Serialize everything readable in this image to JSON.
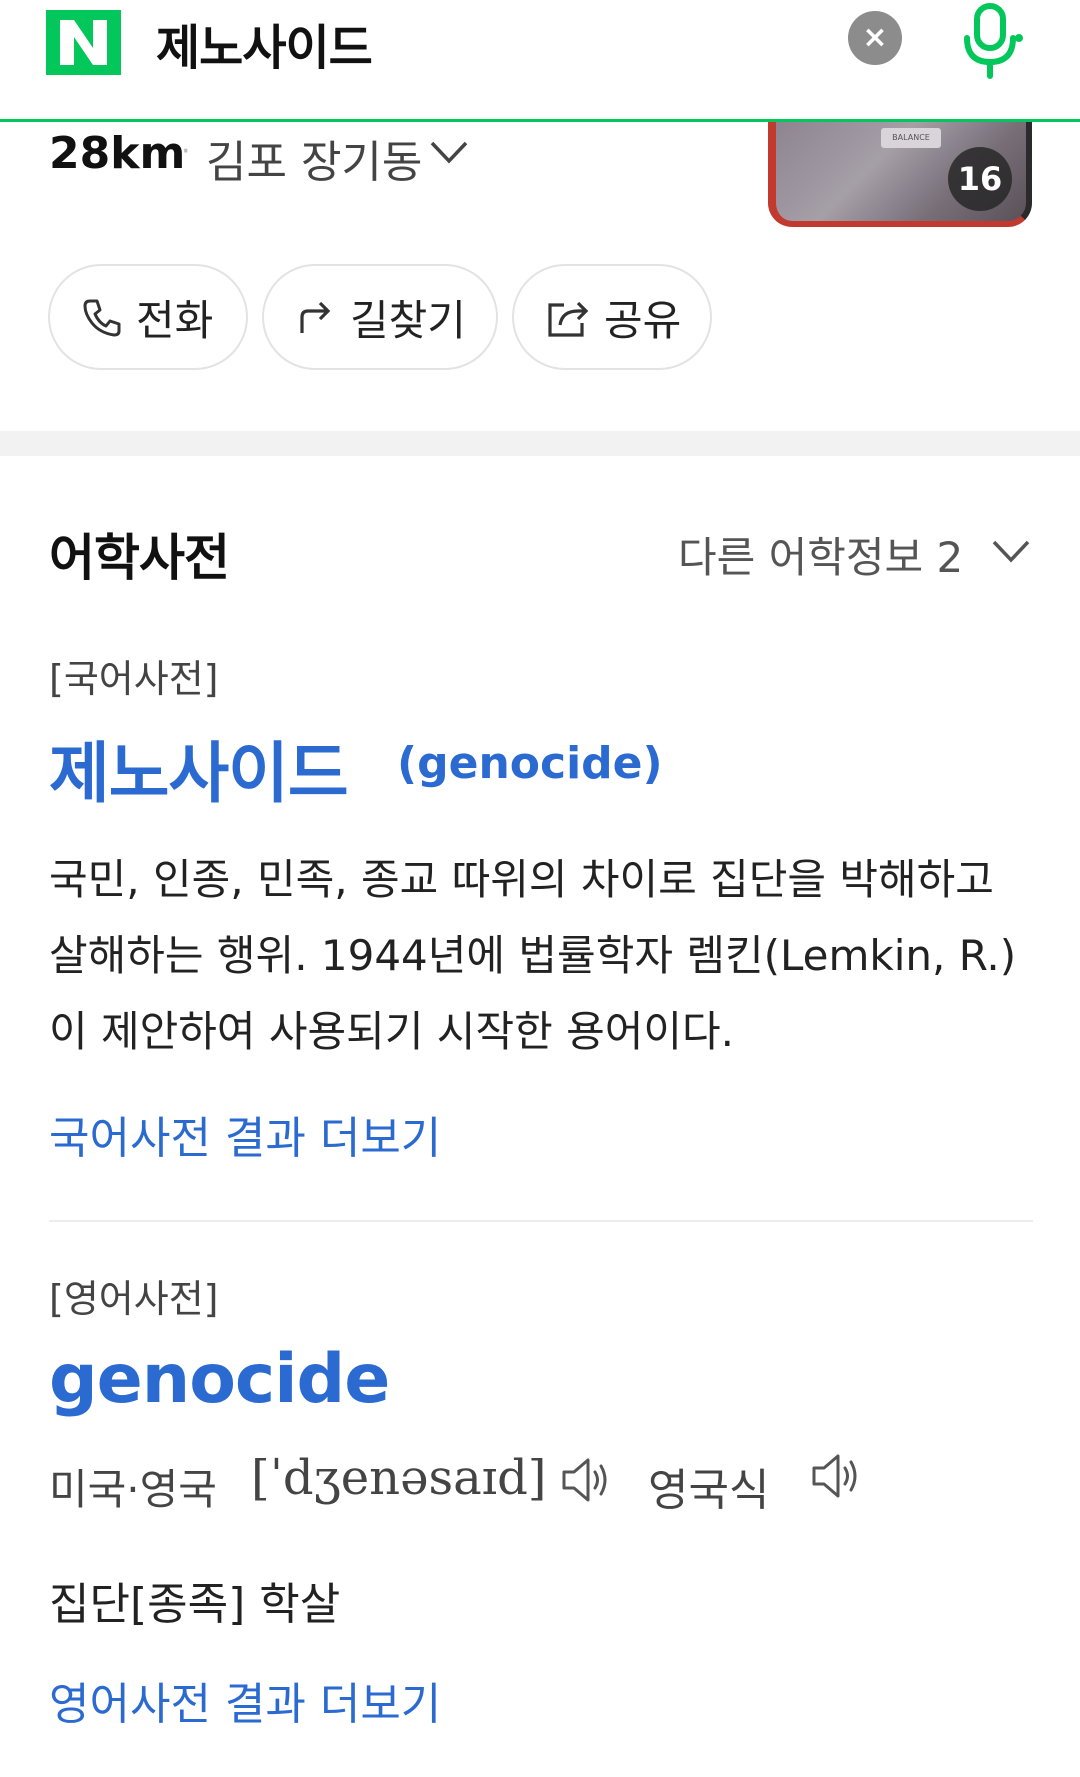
{
  "header": {
    "query": "제노사이드",
    "clear_icon": "×",
    "brand_color": "#03c75a"
  },
  "place": {
    "distance": "28km",
    "dot": "·",
    "address": "김포 장기동",
    "photo_count": "16",
    "photo_tag": "BALANCE",
    "actions": {
      "call": "전화",
      "route": "길찾기",
      "share": "공유"
    }
  },
  "dictionary": {
    "section_title": "어학사전",
    "other_info": "다른 어학정보 2",
    "korean": {
      "label": "[국어사전]",
      "word": "제노사이드",
      "origin": "(genocide)",
      "definition": "국민, 인종, 민족, 종교 따위의 차이로 집단을 박해하고 살해하는 행위. 1944년에 법률학자 렘킨(Lemkin, R.)이 제안하여 사용되기 시작한 용어이다.",
      "more": "국어사전 결과 더보기"
    },
    "english": {
      "label": "[영어사전]",
      "word": "genocide",
      "pron_region": "미국·영국",
      "pron_ipa": "[ˈdʒenəsaɪd]",
      "pron_uk": "영국식",
      "meaning": "집단[종족] 학살",
      "more": "영어사전 결과 더보기"
    },
    "link_color": "#2b6bd1"
  }
}
